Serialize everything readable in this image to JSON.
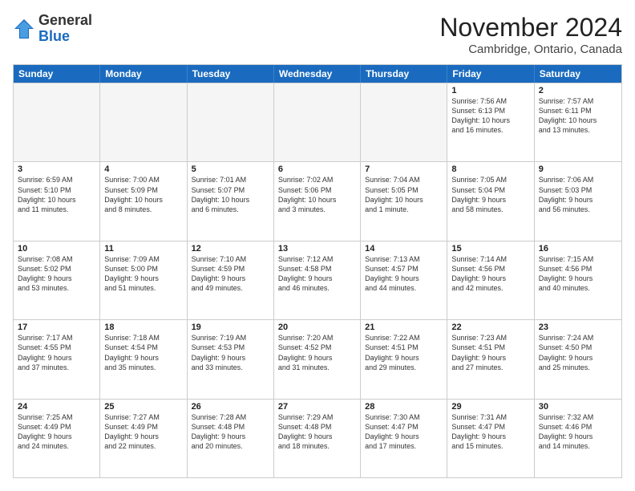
{
  "logo": {
    "general": "General",
    "blue": "Blue"
  },
  "title": "November 2024",
  "location": "Cambridge, Ontario, Canada",
  "days_of_week": [
    "Sunday",
    "Monday",
    "Tuesday",
    "Wednesday",
    "Thursday",
    "Friday",
    "Saturday"
  ],
  "rows": [
    [
      {
        "day": "",
        "info": "",
        "empty": true
      },
      {
        "day": "",
        "info": "",
        "empty": true
      },
      {
        "day": "",
        "info": "",
        "empty": true
      },
      {
        "day": "",
        "info": "",
        "empty": true
      },
      {
        "day": "",
        "info": "",
        "empty": true
      },
      {
        "day": "1",
        "info": "Sunrise: 7:56 AM\nSunset: 6:13 PM\nDaylight: 10 hours\nand 16 minutes."
      },
      {
        "day": "2",
        "info": "Sunrise: 7:57 AM\nSunset: 6:11 PM\nDaylight: 10 hours\nand 13 minutes."
      }
    ],
    [
      {
        "day": "3",
        "info": "Sunrise: 6:59 AM\nSunset: 5:10 PM\nDaylight: 10 hours\nand 11 minutes."
      },
      {
        "day": "4",
        "info": "Sunrise: 7:00 AM\nSunset: 5:09 PM\nDaylight: 10 hours\nand 8 minutes."
      },
      {
        "day": "5",
        "info": "Sunrise: 7:01 AM\nSunset: 5:07 PM\nDaylight: 10 hours\nand 6 minutes."
      },
      {
        "day": "6",
        "info": "Sunrise: 7:02 AM\nSunset: 5:06 PM\nDaylight: 10 hours\nand 3 minutes."
      },
      {
        "day": "7",
        "info": "Sunrise: 7:04 AM\nSunset: 5:05 PM\nDaylight: 10 hours\nand 1 minute."
      },
      {
        "day": "8",
        "info": "Sunrise: 7:05 AM\nSunset: 5:04 PM\nDaylight: 9 hours\nand 58 minutes."
      },
      {
        "day": "9",
        "info": "Sunrise: 7:06 AM\nSunset: 5:03 PM\nDaylight: 9 hours\nand 56 minutes."
      }
    ],
    [
      {
        "day": "10",
        "info": "Sunrise: 7:08 AM\nSunset: 5:02 PM\nDaylight: 9 hours\nand 53 minutes."
      },
      {
        "day": "11",
        "info": "Sunrise: 7:09 AM\nSunset: 5:00 PM\nDaylight: 9 hours\nand 51 minutes."
      },
      {
        "day": "12",
        "info": "Sunrise: 7:10 AM\nSunset: 4:59 PM\nDaylight: 9 hours\nand 49 minutes."
      },
      {
        "day": "13",
        "info": "Sunrise: 7:12 AM\nSunset: 4:58 PM\nDaylight: 9 hours\nand 46 minutes."
      },
      {
        "day": "14",
        "info": "Sunrise: 7:13 AM\nSunset: 4:57 PM\nDaylight: 9 hours\nand 44 minutes."
      },
      {
        "day": "15",
        "info": "Sunrise: 7:14 AM\nSunset: 4:56 PM\nDaylight: 9 hours\nand 42 minutes."
      },
      {
        "day": "16",
        "info": "Sunrise: 7:15 AM\nSunset: 4:56 PM\nDaylight: 9 hours\nand 40 minutes."
      }
    ],
    [
      {
        "day": "17",
        "info": "Sunrise: 7:17 AM\nSunset: 4:55 PM\nDaylight: 9 hours\nand 37 minutes."
      },
      {
        "day": "18",
        "info": "Sunrise: 7:18 AM\nSunset: 4:54 PM\nDaylight: 9 hours\nand 35 minutes."
      },
      {
        "day": "19",
        "info": "Sunrise: 7:19 AM\nSunset: 4:53 PM\nDaylight: 9 hours\nand 33 minutes."
      },
      {
        "day": "20",
        "info": "Sunrise: 7:20 AM\nSunset: 4:52 PM\nDaylight: 9 hours\nand 31 minutes."
      },
      {
        "day": "21",
        "info": "Sunrise: 7:22 AM\nSunset: 4:51 PM\nDaylight: 9 hours\nand 29 minutes."
      },
      {
        "day": "22",
        "info": "Sunrise: 7:23 AM\nSunset: 4:51 PM\nDaylight: 9 hours\nand 27 minutes."
      },
      {
        "day": "23",
        "info": "Sunrise: 7:24 AM\nSunset: 4:50 PM\nDaylight: 9 hours\nand 25 minutes."
      }
    ],
    [
      {
        "day": "24",
        "info": "Sunrise: 7:25 AM\nSunset: 4:49 PM\nDaylight: 9 hours\nand 24 minutes."
      },
      {
        "day": "25",
        "info": "Sunrise: 7:27 AM\nSunset: 4:49 PM\nDaylight: 9 hours\nand 22 minutes."
      },
      {
        "day": "26",
        "info": "Sunrise: 7:28 AM\nSunset: 4:48 PM\nDaylight: 9 hours\nand 20 minutes."
      },
      {
        "day": "27",
        "info": "Sunrise: 7:29 AM\nSunset: 4:48 PM\nDaylight: 9 hours\nand 18 minutes."
      },
      {
        "day": "28",
        "info": "Sunrise: 7:30 AM\nSunset: 4:47 PM\nDaylight: 9 hours\nand 17 minutes."
      },
      {
        "day": "29",
        "info": "Sunrise: 7:31 AM\nSunset: 4:47 PM\nDaylight: 9 hours\nand 15 minutes."
      },
      {
        "day": "30",
        "info": "Sunrise: 7:32 AM\nSunset: 4:46 PM\nDaylight: 9 hours\nand 14 minutes."
      }
    ]
  ]
}
